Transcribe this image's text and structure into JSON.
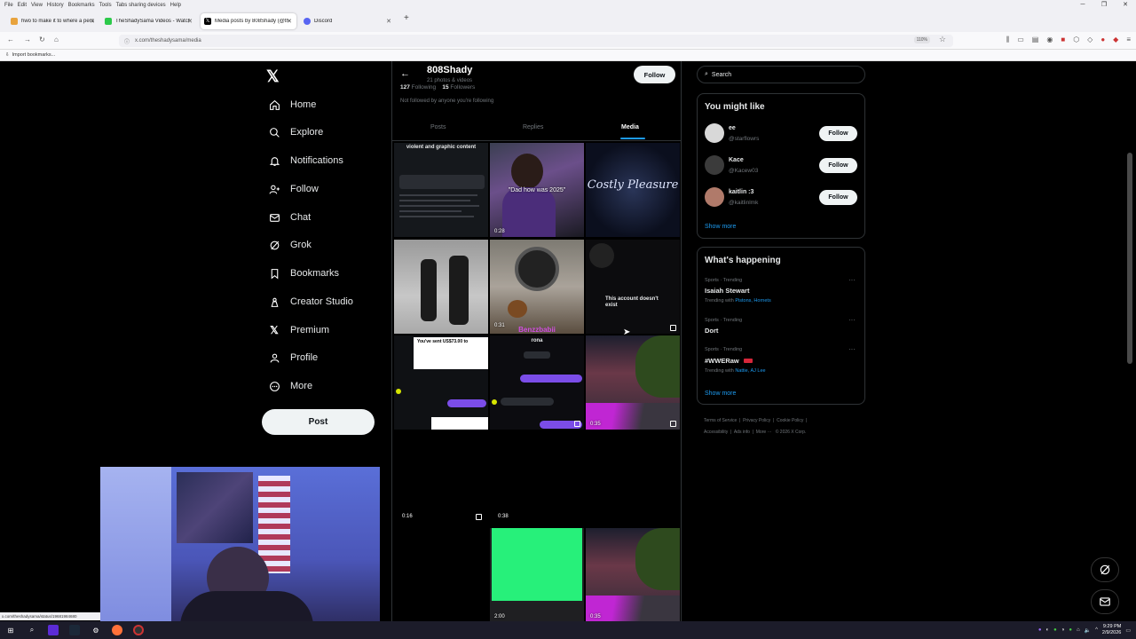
{
  "browser": {
    "menu": [
      "File",
      "Edit",
      "View",
      "History",
      "Bookmarks",
      "Tools",
      "Tabs sharing devices",
      "Help"
    ],
    "tabs": [
      {
        "label": "hwo to make it to where a pers",
        "active": false,
        "color": "#e8a33d"
      },
      {
        "label": "TheShadySama Videos - Watch",
        "active": false,
        "color": "#2cc94a"
      },
      {
        "label": "Media posts by 808Shady (@th",
        "active": true,
        "color": "#000000"
      },
      {
        "label": "Discord",
        "active": false,
        "color": "#5865f2"
      }
    ],
    "url": "x.com/theshadysama/media",
    "zoom": "110%",
    "bookmark_label": "Import bookmarks...",
    "status_url": "x.com/theshadysama/status/19681984680"
  },
  "nav": {
    "items": [
      {
        "label": "Home",
        "icon": "home-icon"
      },
      {
        "label": "Explore",
        "icon": "search-icon"
      },
      {
        "label": "Notifications",
        "icon": "bell-icon"
      },
      {
        "label": "Follow",
        "icon": "add-user-icon"
      },
      {
        "label": "Chat",
        "icon": "mail-icon"
      },
      {
        "label": "Grok",
        "icon": "grok-icon"
      },
      {
        "label": "Bookmarks",
        "icon": "bookmark-icon"
      },
      {
        "label": "Creator Studio",
        "icon": "creator-icon"
      },
      {
        "label": "Premium",
        "icon": "x-icon"
      },
      {
        "label": "Profile",
        "icon": "person-icon"
      },
      {
        "label": "More",
        "icon": "more-icon"
      }
    ],
    "post_label": "Post"
  },
  "profile": {
    "name": "808Shady",
    "subtitle": "21 photos & videos",
    "following_count": "127",
    "following_label": "Following",
    "followers_count": "15",
    "followers_label": "Followers",
    "not_followed": "Not followed by anyone you're following",
    "follow_label": "Follow",
    "tabs": [
      "Posts",
      "Replies",
      "Media"
    ],
    "active_tab": "Media"
  },
  "media": {
    "t1_title": "violent and graphic content",
    "t2_caption": "\"Dad how was 2025\"",
    "t2_duration": "0:28",
    "t3_caption": "Costly Pleasure",
    "t5_duration": "0:31",
    "t5_caption": "Benzzbabii",
    "t6_caption": "This account doesn't exist",
    "t7_caption": "You've sent US$73.00 to",
    "t8_name": "rona",
    "t9_duration": "0:35",
    "row4_dur1": "0:16",
    "row4_dur2": "0:38",
    "t11_duration": "2:00",
    "t12_duration": "0:35"
  },
  "right": {
    "search_placeholder": "Search",
    "you_might_like": "You might like",
    "suggestions": [
      {
        "name": "ee",
        "handle": "@starflowrs",
        "follow": "Follow"
      },
      {
        "name": "Kace",
        "handle": "@Kacew03",
        "follow": "Follow"
      },
      {
        "name": "kaitlin :3",
        "handle": "@kaitlinlmk",
        "follow": "Follow"
      }
    ],
    "show_more": "Show more",
    "whats_happening": "What's happening",
    "trends": [
      {
        "category": "Sports · Trending",
        "name": "Isaiah Stewart",
        "with_label": "Trending with",
        "with": "Pistons, Hornets"
      },
      {
        "category": "Sports · Trending",
        "name": "Dort",
        "with_label": "",
        "with": ""
      },
      {
        "category": "Sports · Trending",
        "name": "#WWERaw",
        "with_label": "Trending with",
        "with": "Nattie, AJ Lee"
      }
    ],
    "trends_show_more": "Show more",
    "footer": [
      "Terms of Service",
      "Privacy Policy",
      "Cookie Policy",
      "Accessibility",
      "Ads info",
      "More ···",
      "© 2026 X Corp."
    ]
  },
  "taskbar": {
    "time": "9:29 PM",
    "date": "2/9/2026"
  }
}
